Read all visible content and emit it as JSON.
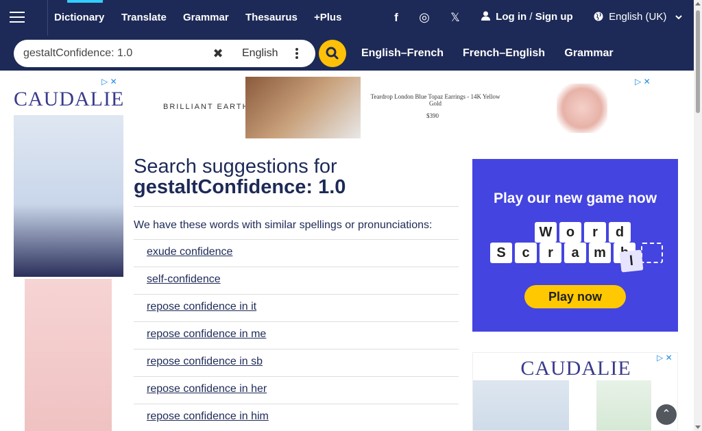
{
  "nav": {
    "items": [
      {
        "label": "Dictionary"
      },
      {
        "label": "Translate"
      },
      {
        "label": "Grammar"
      },
      {
        "label": "Thesaurus"
      },
      {
        "label": "+Plus"
      }
    ]
  },
  "social": {
    "facebook": "f",
    "instagram": "◎",
    "x": "𝕏"
  },
  "account": {
    "login": "Log in",
    "sep": " / ",
    "signup": "Sign up"
  },
  "language": {
    "label": "English (UK)"
  },
  "search": {
    "value": "gestaltConfidence: 1.0",
    "lang": "English"
  },
  "subnav": {
    "items": [
      {
        "label": "English–French"
      },
      {
        "label": "French–English"
      },
      {
        "label": "Grammar"
      }
    ]
  },
  "ads": {
    "left_brand": "CAUDALIE",
    "top": {
      "brand": "BRILLIANT EARTH",
      "desc": "Teardrop London Blue Topaz Earrings - 14K Yellow Gold",
      "price": "$390"
    },
    "game": {
      "headline": "Play our new game now",
      "row1": [
        "W",
        "o",
        "r",
        "d"
      ],
      "row2": [
        "S",
        "c",
        "r",
        "a",
        "m",
        "b",
        "l"
      ],
      "cta": "Play now"
    },
    "right_brand": "CAUDALIE"
  },
  "main": {
    "title_prefix": "Search suggestions for",
    "title_term": "gestaltConfidence: 1.0",
    "intro": "We have these words with similar spellings or pronunciations:",
    "suggestions": [
      "exude confidence",
      "self-confidence",
      "repose confidence in it",
      "repose confidence in me",
      "repose confidence in sb",
      "repose confidence in her",
      "repose confidence in him"
    ]
  }
}
